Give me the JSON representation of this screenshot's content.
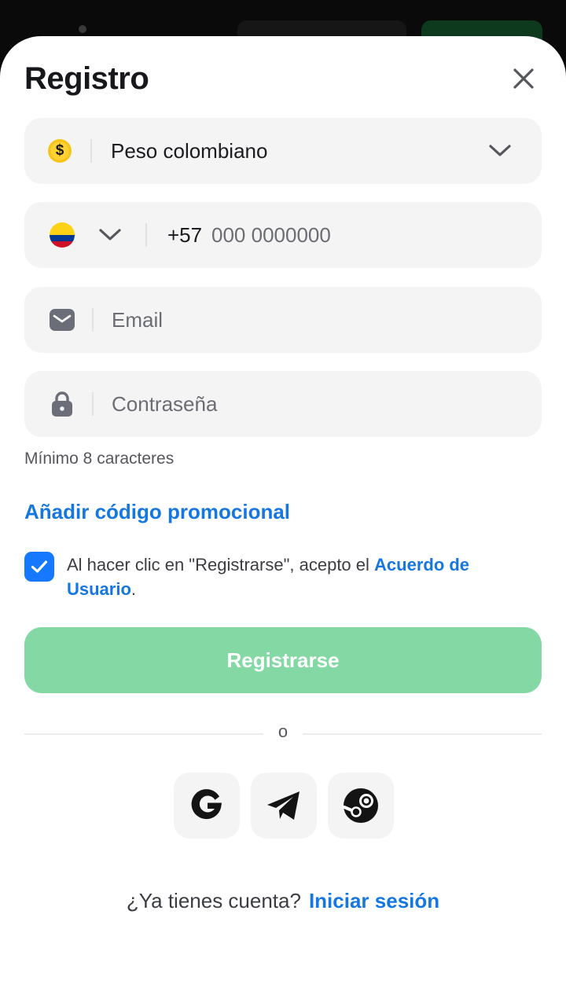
{
  "modal": {
    "title": "Registro"
  },
  "currency": {
    "value": "Peso colombiano",
    "symbol": "$",
    "icon": "coin-icon",
    "accent_color": "#f5c51c"
  },
  "phone": {
    "country_icon": "colombia-flag-icon",
    "prefix": "+57",
    "placeholder": "000 0000000"
  },
  "email": {
    "icon": "envelope-icon",
    "placeholder": "Email"
  },
  "password": {
    "icon": "lock-icon",
    "placeholder": "Contraseña",
    "hint": "Mínimo 8 caracteres"
  },
  "promo": {
    "label": "Añadir código promocional"
  },
  "terms": {
    "checked": true,
    "text": "Al hacer clic en \"Registrarse\", acepto el ",
    "link": "Acuerdo de Usuario",
    "suffix": "."
  },
  "register": {
    "label": "Registrarse",
    "color": "#83d8a4"
  },
  "divider": {
    "label": "o"
  },
  "social": [
    {
      "name": "google",
      "icon": "google-icon"
    },
    {
      "name": "telegram",
      "icon": "telegram-icon"
    },
    {
      "name": "steam",
      "icon": "steam-icon"
    }
  ],
  "footer": {
    "question": "¿Ya tienes cuenta?",
    "login_label": "Iniciar sesión"
  },
  "colors": {
    "link": "#1677e0",
    "checkbox": "#1677ff"
  }
}
